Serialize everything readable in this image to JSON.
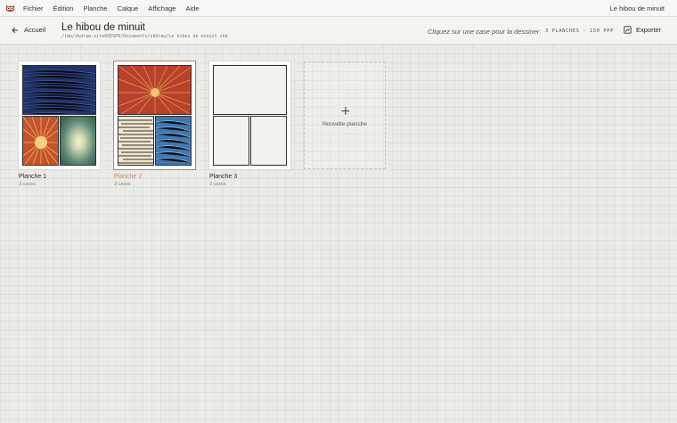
{
  "menubar": {
    "logo": "owl-logo-icon",
    "items": [
      {
        "label": "Fichier"
      },
      {
        "label": "Édition"
      },
      {
        "label": "Planche"
      },
      {
        "label": "Calque"
      },
      {
        "label": "Affichage"
      },
      {
        "label": "Aide"
      }
    ],
    "document_name": "Le hibou de minuit"
  },
  "header": {
    "back_label": "Accueil",
    "back_icon": "arrow-left-icon",
    "title": "Le hibou de minuit",
    "path": "/tmp/zkdraw-site0QEQP6/Documents/zkDraw/Le hibou de minuit.zkd",
    "hint": "Cliquez sur une case pour la dessiner",
    "stats": "3 PLANCHES · 150 PPP",
    "export_label": "Exporter",
    "export_icon": "export-icon"
  },
  "boards": [
    {
      "name": "Planche 1",
      "count": "3 cases",
      "selected": false
    },
    {
      "name": "Planche 2",
      "count": "3 cases",
      "selected": true
    },
    {
      "name": "Planche 3",
      "count": "3 cases",
      "selected": false
    }
  ],
  "new_board": {
    "label": "Nouvelle planche",
    "icon": "plus-icon"
  },
  "colors": {
    "accent": "#c0865a",
    "background": "#ebebe8",
    "panel_border": "#2e2e2e"
  }
}
